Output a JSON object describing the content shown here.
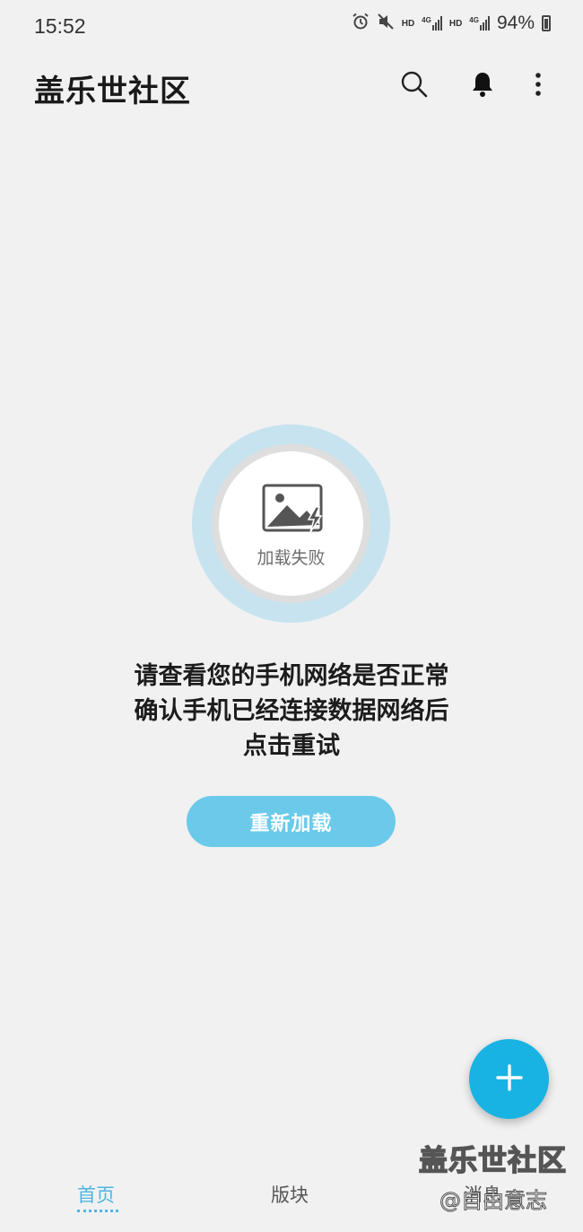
{
  "status_bar": {
    "time": "15:52",
    "network_1": "HD",
    "network_1_type": "4G",
    "network_2": "HD",
    "network_2_type": "4G",
    "battery": "94%"
  },
  "app_bar": {
    "title": "盖乐世社区",
    "icons": [
      "search-icon",
      "bell-icon",
      "more-vert-icon"
    ]
  },
  "error": {
    "image_label": "加载失败",
    "message_lines": [
      "请查看您的手机网络是否正常",
      "确认手机已经连接数据网络后",
      "点击重试"
    ],
    "reload_label": "重新加载"
  },
  "fab": {
    "icon": "plus-icon"
  },
  "bottom_nav": {
    "items": [
      {
        "label": "首页",
        "active": true
      },
      {
        "label": "版块",
        "active": false
      },
      {
        "label": "消息",
        "active": false
      }
    ]
  },
  "watermark": {
    "title": "盖乐世社区",
    "subtitle": "@自由意志"
  },
  "colors": {
    "background": "#f1f1f2",
    "accent": "#4fb6e0",
    "button": "#6bcaea",
    "fab": "#18b3e3"
  }
}
